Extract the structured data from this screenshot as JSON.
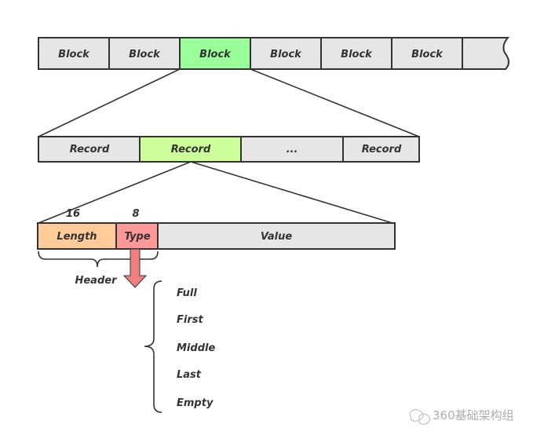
{
  "colors": {
    "gray": "#e6e6e6",
    "green_block": "#99ff99",
    "green_record": "#ccff99",
    "length": "#ffcc99",
    "type": "#ff9999",
    "arrow": "#f08080"
  },
  "blocks": [
    "Block",
    "Block",
    "Block",
    "Block",
    "Block",
    "Block"
  ],
  "records": [
    "Record",
    "Record",
    "...",
    "Record"
  ],
  "fields": {
    "length": "Length",
    "type": "Type",
    "value": "Value",
    "length_bits": "16",
    "type_bits": "8",
    "header": "Header"
  },
  "types": [
    "Full",
    "First",
    "Middle",
    "Last",
    "Empty"
  ],
  "watermark": "360基础架构组"
}
